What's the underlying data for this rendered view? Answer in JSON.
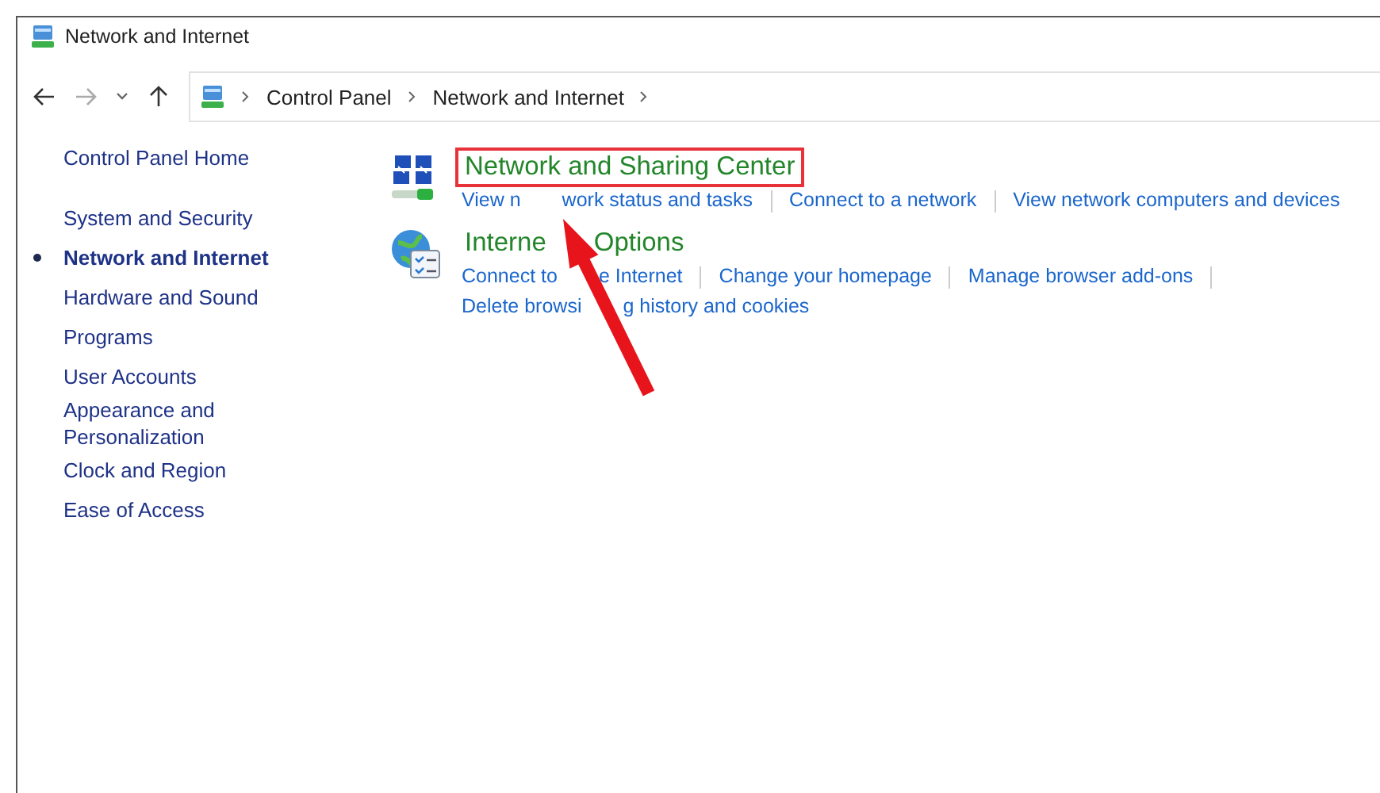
{
  "window": {
    "title": "Network and Internet"
  },
  "address_bar": {
    "crumbs": [
      "Control Panel",
      "Network and Internet"
    ]
  },
  "sidebar": {
    "home": "Control Panel Home",
    "items": [
      {
        "label": "System and Security",
        "selected": false
      },
      {
        "label": "Network and Internet",
        "selected": true
      },
      {
        "label": "Hardware and Sound",
        "selected": false
      },
      {
        "label": "Programs",
        "selected": false
      },
      {
        "label": "User Accounts",
        "selected": false
      },
      {
        "label": "Appearance and Personalization",
        "selected": false
      },
      {
        "label": "Clock and Region",
        "selected": false
      },
      {
        "label": "Ease of Access",
        "selected": false
      }
    ]
  },
  "categories": [
    {
      "kind": "network",
      "title": [
        "Network and Sharing Center"
      ],
      "highlighted": true,
      "links": [
        [
          "View n",
          "work status and tasks"
        ],
        [
          "Connect to a network"
        ],
        [
          "View network computers and devices"
        ]
      ]
    },
    {
      "kind": "internet",
      "title": [
        "Interne",
        "Options"
      ],
      "highlighted": false,
      "links": [
        [
          "Connect to",
          "e Internet"
        ],
        [
          "Change your homepage"
        ],
        [
          "Manage browser add-ons"
        ],
        [
          "Delete browsi",
          "g history and cookies"
        ]
      ]
    }
  ]
}
